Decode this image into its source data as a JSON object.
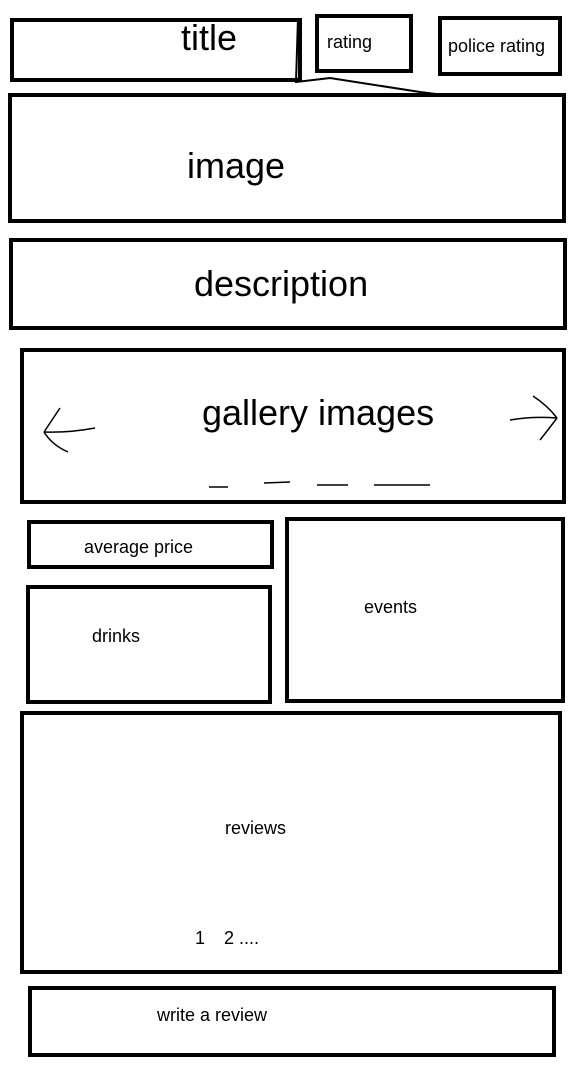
{
  "header": {
    "title": "title",
    "rating": "rating",
    "police_rating": "police rating"
  },
  "main": {
    "image": "image",
    "description": "description"
  },
  "gallery": {
    "label": "gallery images",
    "prev_icon": "arrow-left-icon",
    "next_icon": "arrow-right-icon",
    "page_indicators": 4
  },
  "info": {
    "average_price": "average price",
    "drinks": "drinks",
    "events": "events"
  },
  "reviews": {
    "label": "reviews",
    "pagination": [
      "1",
      "2 ...."
    ]
  },
  "actions": {
    "write_review": "write a review"
  }
}
